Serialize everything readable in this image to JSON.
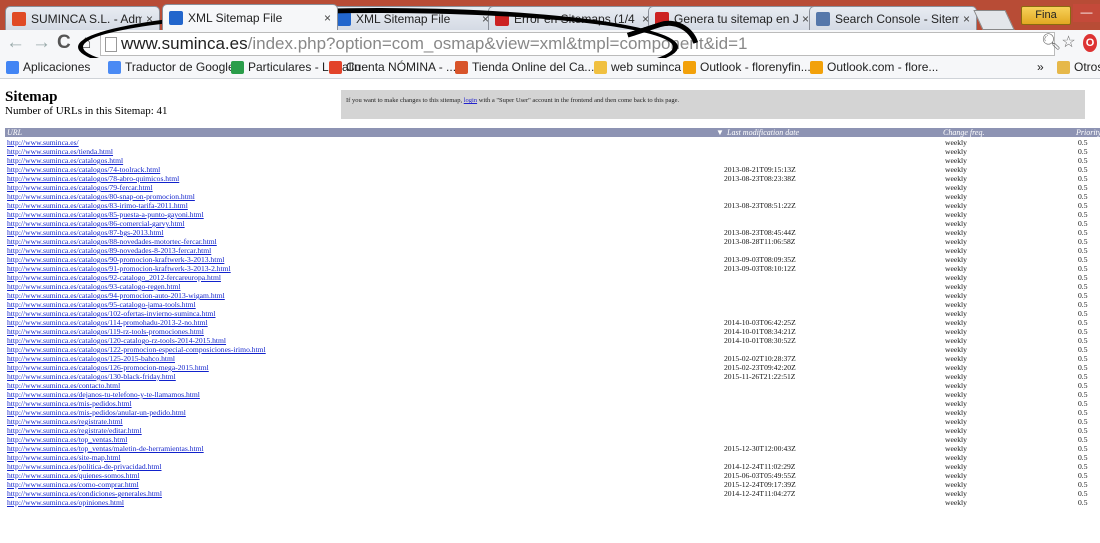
{
  "browser": {
    "tabs": [
      {
        "title": "SUMINCA S.L. - Administ",
        "icon": "joomla-icon",
        "color": "#e04a25"
      },
      {
        "title": "XML Sitemap File",
        "icon": "osmap-icon",
        "color": "#2266cc",
        "active": true
      },
      {
        "title": "XML Sitemap File",
        "icon": "osmap-icon",
        "color": "#2266cc"
      },
      {
        "title": "Error en Sitemaps (1/4",
        "icon": "w-icon",
        "color": "#cc2222"
      },
      {
        "title": "Genera tu sitemap en Joo",
        "icon": "w-icon",
        "color": "#cc2222"
      },
      {
        "title": "Search Console - Sitemap",
        "icon": "search-console-icon",
        "color": "#5577aa"
      }
    ],
    "user_button": "Fina",
    "url_host": "www.suminca.es",
    "url_rest": "/index.php?option=com_osmap&view=xml&tmpl=component&id=1",
    "bookmarks": [
      {
        "label": "Aplicaciones",
        "color": "#4285f4"
      },
      {
        "label": "Traductor de Google",
        "color": "#4a8af4"
      },
      {
        "label": "Particulares - Logalin",
        "color": "#2a9d4a"
      },
      {
        "label": "Cuenta NÓMINA - ...",
        "color": "#e2432a"
      },
      {
        "label": "Tienda Online del Ca...",
        "color": "#d8542a"
      },
      {
        "label": "web suminca",
        "color": "#f0c040"
      },
      {
        "label": "Outlook - florenyfin...",
        "color": "#f2a10a"
      },
      {
        "label": "Outlook.com - flore...",
        "color": "#f2a10a"
      }
    ],
    "bookmarks_more": "»",
    "other_bookmarks": "Otros"
  },
  "sitemap": {
    "title": "Sitemap",
    "count_label": "Number of URLs in this Sitemap: 41",
    "notice_pre": "If you want to make changes to this sitemap, ",
    "notice_link": "login",
    "notice_post": " with a \"Super User\" account in the frontend and then come back to this page.",
    "columns": {
      "url": "URL",
      "lastmod": "Last modification date",
      "freq": "Change freq.",
      "priority": "Priority"
    },
    "rows": [
      {
        "url": "http://www.suminca.es/",
        "lastmod": "",
        "freq": "weekly",
        "priority": "0.5"
      },
      {
        "url": "http://www.suminca.es/tienda.html",
        "lastmod": "",
        "freq": "weekly",
        "priority": "0.5"
      },
      {
        "url": "http://www.suminca.es/catalogos.html",
        "lastmod": "",
        "freq": "weekly",
        "priority": "0.5"
      },
      {
        "url": "http://www.suminca.es/catalogos/74-toolrack.html",
        "lastmod": "2013-08-21T09:15:13Z",
        "freq": "weekly",
        "priority": "0.5"
      },
      {
        "url": "http://www.suminca.es/catalogos/78-abro-quimicos.html",
        "lastmod": "2013-08-23T08:23:38Z",
        "freq": "weekly",
        "priority": "0.5"
      },
      {
        "url": "http://www.suminca.es/catalogos/79-fercar.html",
        "lastmod": "",
        "freq": "weekly",
        "priority": "0.5"
      },
      {
        "url": "http://www.suminca.es/catalogos/80-snap-on-promocion.html",
        "lastmod": "",
        "freq": "weekly",
        "priority": "0.5"
      },
      {
        "url": "http://www.suminca.es/catalogos/83-irimo-tarifa-2011.html",
        "lastmod": "2013-08-23T08:51:22Z",
        "freq": "weekly",
        "priority": "0.5"
      },
      {
        "url": "http://www.suminca.es/catalogos/85-puesta-a-punto-gayoni.html",
        "lastmod": "",
        "freq": "weekly",
        "priority": "0.5"
      },
      {
        "url": "http://www.suminca.es/catalogos/86-comercial-garvy.html",
        "lastmod": "",
        "freq": "weekly",
        "priority": "0.5"
      },
      {
        "url": "http://www.suminca.es/catalogos/87-bgs-2013.html",
        "lastmod": "2013-08-23T08:45:44Z",
        "freq": "weekly",
        "priority": "0.5"
      },
      {
        "url": "http://www.suminca.es/catalogos/88-novedades-motortec-fercar.html",
        "lastmod": "2013-08-28T11:06:58Z",
        "freq": "weekly",
        "priority": "0.5"
      },
      {
        "url": "http://www.suminca.es/catalogos/89-novedades-8-2013-fercar.html",
        "lastmod": "",
        "freq": "weekly",
        "priority": "0.5"
      },
      {
        "url": "http://www.suminca.es/catalogos/90-promocion-kraftwerk-3-2013.html",
        "lastmod": "2013-09-03T08:09:35Z",
        "freq": "weekly",
        "priority": "0.5"
      },
      {
        "url": "http://www.suminca.es/catalogos/91-promocion-kraftwerk-3-2013-2.html",
        "lastmod": "2013-09-03T08:10:12Z",
        "freq": "weekly",
        "priority": "0.5"
      },
      {
        "url": "http://www.suminca.es/catalogos/92-catalogo_2012-fercareuropa.html",
        "lastmod": "",
        "freq": "weekly",
        "priority": "0.5"
      },
      {
        "url": "http://www.suminca.es/catalogos/93-catalogo-regen.html",
        "lastmod": "",
        "freq": "weekly",
        "priority": "0.5"
      },
      {
        "url": "http://www.suminca.es/catalogos/94-promocion-auto-2013-wigam.html",
        "lastmod": "",
        "freq": "weekly",
        "priority": "0.5"
      },
      {
        "url": "http://www.suminca.es/catalogos/95-catalogo-jama-tools.html",
        "lastmod": "",
        "freq": "weekly",
        "priority": "0.5"
      },
      {
        "url": "http://www.suminca.es/catalogos/102-ofertas-invierno-suminca.html",
        "lastmod": "",
        "freq": "weekly",
        "priority": "0.5"
      },
      {
        "url": "http://www.suminca.es/catalogos/114-promohadu-2013-2-no.html",
        "lastmod": "2014-10-03T06:42:25Z",
        "freq": "weekly",
        "priority": "0.5"
      },
      {
        "url": "http://www.suminca.es/catalogos/119-rz-tools-promociones.html",
        "lastmod": "2014-10-01T08:34:21Z",
        "freq": "weekly",
        "priority": "0.5"
      },
      {
        "url": "http://www.suminca.es/catalogos/120-catalogo-rz-tools-2014-2015.html",
        "lastmod": "2014-10-01T08:30:52Z",
        "freq": "weekly",
        "priority": "0.5"
      },
      {
        "url": "http://www.suminca.es/catalogos/122-promocion-especial-composiciones-irimo.html",
        "lastmod": "",
        "freq": "weekly",
        "priority": "0.5"
      },
      {
        "url": "http://www.suminca.es/catalogos/125-2015-bahco.html",
        "lastmod": "2015-02-02T10:28:37Z",
        "freq": "weekly",
        "priority": "0.5"
      },
      {
        "url": "http://www.suminca.es/catalogos/126-promocion-mega-2015.html",
        "lastmod": "2015-02-23T09:42:20Z",
        "freq": "weekly",
        "priority": "0.5"
      },
      {
        "url": "http://www.suminca.es/catalogos/130-black-friday.html",
        "lastmod": "2015-11-26T21:22:51Z",
        "freq": "weekly",
        "priority": "0.5"
      },
      {
        "url": "http://www.suminca.es/contacto.html",
        "lastmod": "",
        "freq": "weekly",
        "priority": "0.5"
      },
      {
        "url": "http://www.suminca.es/dejanos-tu-telefono-y-te-llamamos.html",
        "lastmod": "",
        "freq": "weekly",
        "priority": "0.5"
      },
      {
        "url": "http://www.suminca.es/mis-pedidos.html",
        "lastmod": "",
        "freq": "weekly",
        "priority": "0.5"
      },
      {
        "url": "http://www.suminca.es/mis-pedidos/anular-un-pedido.html",
        "lastmod": "",
        "freq": "weekly",
        "priority": "0.5"
      },
      {
        "url": "http://www.suminca.es/registrate.html",
        "lastmod": "",
        "freq": "weekly",
        "priority": "0.5"
      },
      {
        "url": "http://www.suminca.es/registrate/editar.html",
        "lastmod": "",
        "freq": "weekly",
        "priority": "0.5"
      },
      {
        "url": "http://www.suminca.es/top_ventas.html",
        "lastmod": "",
        "freq": "weekly",
        "priority": "0.5"
      },
      {
        "url": "http://www.suminca.es/top_ventas/maletin-de-herramientas.html",
        "lastmod": "2015-12-30T12:00:43Z",
        "freq": "weekly",
        "priority": "0.5"
      },
      {
        "url": "http://www.suminca.es/site-map.html",
        "lastmod": "",
        "freq": "weekly",
        "priority": "0.5"
      },
      {
        "url": "http://www.suminca.es/politica-de-privacidad.html",
        "lastmod": "2014-12-24T11:02:29Z",
        "freq": "weekly",
        "priority": "0.5"
      },
      {
        "url": "http://www.suminca.es/quienes-somos.html",
        "lastmod": "2015-06-03T05:49:55Z",
        "freq": "weekly",
        "priority": "0.5"
      },
      {
        "url": "http://www.suminca.es/como-comprar.html",
        "lastmod": "2015-12-24T09:17:39Z",
        "freq": "weekly",
        "priority": "0.5"
      },
      {
        "url": "http://www.suminca.es/condiciones-generales.html",
        "lastmod": "2014-12-24T11:04:27Z",
        "freq": "weekly",
        "priority": "0.5"
      },
      {
        "url": "http://www.suminca.es/opiniones.html",
        "lastmod": "",
        "freq": "weekly",
        "priority": "0.5"
      }
    ]
  }
}
